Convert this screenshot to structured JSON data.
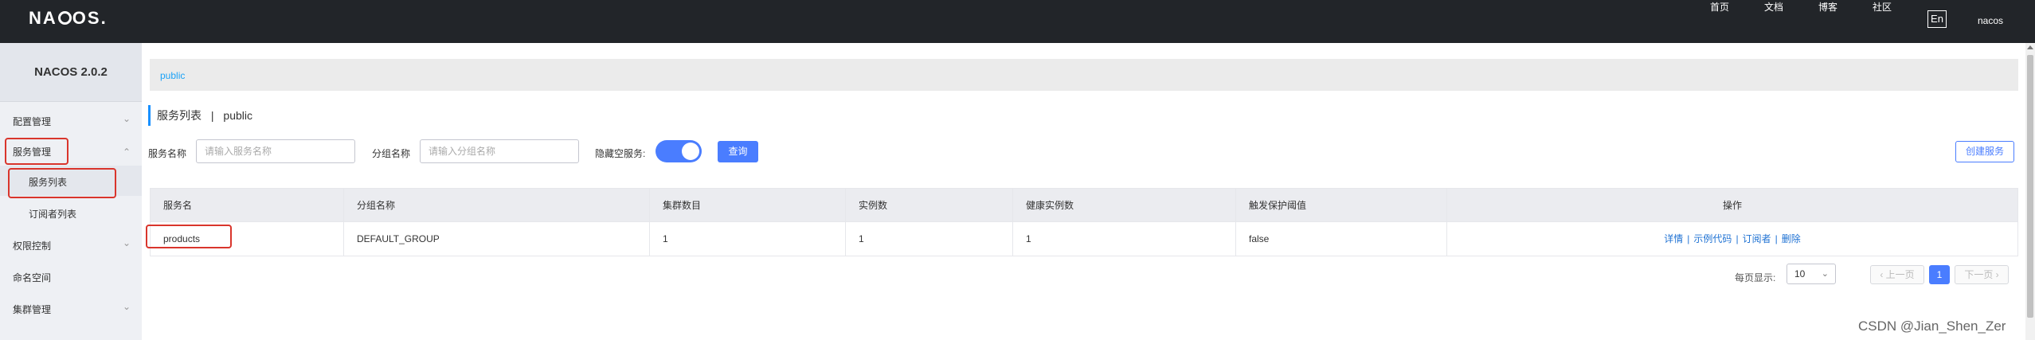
{
  "brand": {
    "logo": "NACOS."
  },
  "topnav": {
    "items": [
      "首页",
      "文档",
      "博客",
      "社区"
    ],
    "lang": "En",
    "user": "nacos"
  },
  "sidebar": {
    "title": "NACOS 2.0.2",
    "items": [
      {
        "label": "配置管理",
        "chevron": "chevron-down"
      },
      {
        "label": "服务管理",
        "chevron": "chevron-up"
      },
      {
        "label": "服务列表"
      },
      {
        "label": "订阅者列表"
      },
      {
        "label": "权限控制",
        "chevron": "chevron-down"
      },
      {
        "label": "命名空间"
      },
      {
        "label": "集群管理",
        "chevron": "chevron-down"
      }
    ]
  },
  "main": {
    "namespace_tab": "public",
    "heading": {
      "title": "服务列表",
      "sep": "|",
      "namespace": "public"
    },
    "filters": {
      "service_name_label": "服务名称",
      "service_name_placeholder": "请输入服务名称",
      "group_name_label": "分组名称",
      "group_name_placeholder": "请输入分组名称",
      "hide_empty_label": "隐藏空服务:",
      "hide_empty_on": true,
      "search_label": "查询",
      "create_label": "创建服务"
    },
    "table": {
      "columns": [
        "服务名",
        "分组名称",
        "集群数目",
        "实例数",
        "健康实例数",
        "触发保护阈值",
        "操作"
      ],
      "rows": [
        {
          "service": "products",
          "group": "DEFAULT_GROUP",
          "clusters": "1",
          "instances": "1",
          "healthy": "1",
          "protect": "false"
        }
      ],
      "ops": [
        "详情",
        "示例代码",
        "订阅者",
        "删除"
      ]
    },
    "pagination": {
      "per_page_label": "每页显示:",
      "page_size": "10",
      "prev": "上一页",
      "current": "1",
      "next": "下一页"
    }
  },
  "watermark": "CSDN @Jian_Shen_Zer",
  "colors": {
    "accent": "#4a7dff",
    "highlight_box": "#d9352c",
    "link": "#1f72d3"
  }
}
